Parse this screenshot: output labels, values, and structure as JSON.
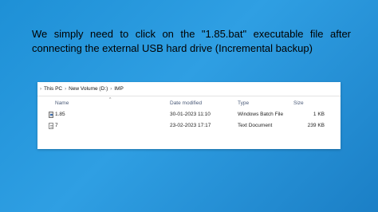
{
  "slide": {
    "caption_line1": "We simply need to click on the \"1.85.bat\" executable file after",
    "caption_line2": "connecting the external USB hard drive (Incremental backup)"
  },
  "explorer": {
    "breadcrumb": [
      "This PC",
      "New Volume (D:)",
      "IMP"
    ],
    "columns": {
      "name": "Name",
      "date_modified": "Date modified",
      "type": "Type",
      "size": "Size"
    },
    "files": [
      {
        "name": "1.85",
        "date_modified": "30-01-2023 11:10",
        "type": "Windows Batch File",
        "size": "1 KB",
        "icon": "batch-file-icon"
      },
      {
        "name": "7",
        "date_modified": "23-02-2023 17:17",
        "type": "Text Document",
        "size": "239 KB",
        "icon": "text-file-icon"
      }
    ]
  }
}
